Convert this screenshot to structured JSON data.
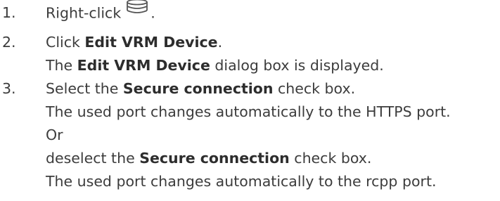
{
  "steps": [
    {
      "number": "1.",
      "text_before": "Right-click",
      "icon": "storage-device-icon",
      "text_after": "."
    },
    {
      "number": "2.",
      "text_before": "Click ",
      "bold": "Edit VRM Device",
      "text_after": ".",
      "result": {
        "before": "The ",
        "bold": "Edit VRM Device",
        "after": " dialog box is displayed."
      }
    },
    {
      "number": "3.",
      "text_before": "Select the ",
      "bold": "Secure connection",
      "text_after": " check box.",
      "result_1": "The used port changes automatically to the HTTPS port.",
      "or": "Or",
      "alt": {
        "before": "deselect the ",
        "bold": "Secure connection",
        "after": " check box."
      },
      "result_2": "The used port changes automatically to the rcpp port."
    }
  ]
}
